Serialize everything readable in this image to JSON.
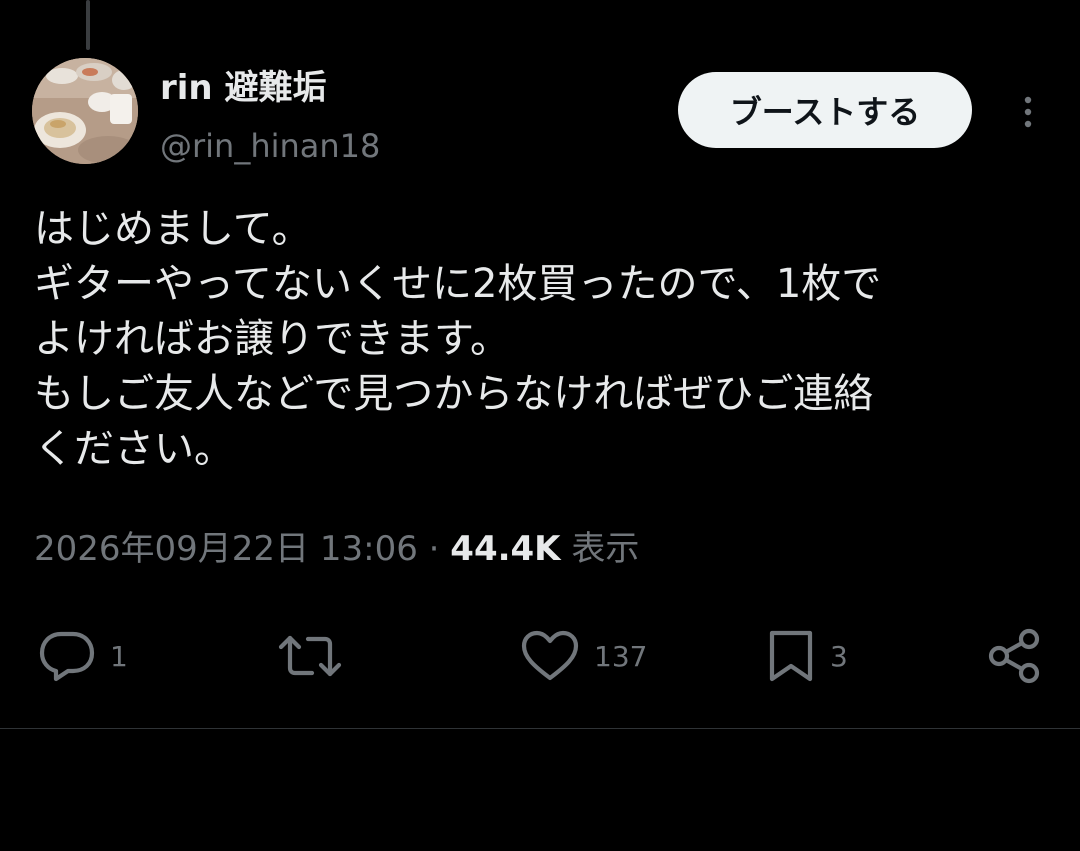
{
  "author": {
    "display_name": "rin 避難垢",
    "handle": "@rin_hinan18"
  },
  "header": {
    "boost_label": "ブーストする"
  },
  "post": {
    "lines": [
      "はじめまして。",
      "ギターやってないくせに2枚買ったので、1枚で",
      "よければお譲りできます。",
      "もしご友人などで見つからなければぜひご連絡",
      "ください。"
    ]
  },
  "meta": {
    "timestamp": "2026年09月22日 13:06",
    "separator": "·",
    "views_count": "44.4K",
    "views_label": "表示"
  },
  "actions": {
    "reply_count": "1",
    "repost_count": "",
    "like_count": "137",
    "bookmark_count": "3"
  },
  "icons": {
    "reply": "reply-icon",
    "repost": "repost-icon",
    "like": "heart-icon",
    "bookmark": "bookmark-icon",
    "share": "share-icon",
    "more": "more-vertical-icon"
  },
  "colors": {
    "background": "#000000",
    "text_primary": "#e7e9ea",
    "text_secondary": "#71767b",
    "button_bg": "#eff3f4",
    "button_text": "#0f1419",
    "divider": "#2f3336"
  }
}
